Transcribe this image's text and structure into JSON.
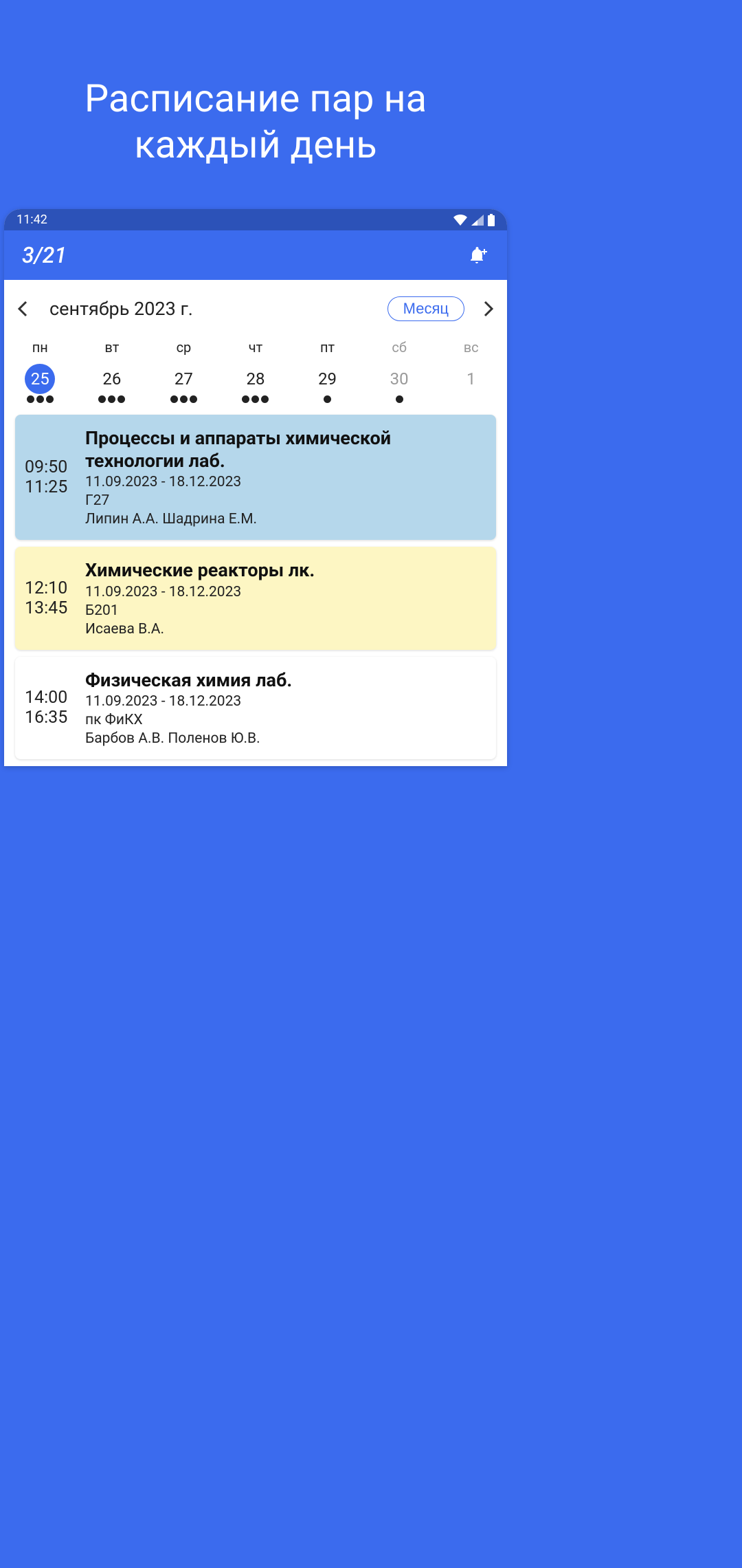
{
  "promo": {
    "title": "Расписание пар на каждый день"
  },
  "status_bar": {
    "time": "11:42"
  },
  "app_bar": {
    "title": "3/21"
  },
  "calendar": {
    "month_label": "сентябрь 2023 г.",
    "view_mode": "Месяц",
    "weekdays": [
      {
        "label": "пн",
        "muted": false
      },
      {
        "label": "вт",
        "muted": false
      },
      {
        "label": "ср",
        "muted": false
      },
      {
        "label": "чт",
        "muted": false
      },
      {
        "label": "пт",
        "muted": false
      },
      {
        "label": "сб",
        "muted": true
      },
      {
        "label": "вс",
        "muted": true
      }
    ],
    "days": [
      {
        "num": "25",
        "selected": true,
        "muted": false,
        "dots": 3
      },
      {
        "num": "26",
        "selected": false,
        "muted": false,
        "dots": 3
      },
      {
        "num": "27",
        "selected": false,
        "muted": false,
        "dots": 3
      },
      {
        "num": "28",
        "selected": false,
        "muted": false,
        "dots": 3
      },
      {
        "num": "29",
        "selected": false,
        "muted": false,
        "dots": 1
      },
      {
        "num": "30",
        "selected": false,
        "muted": true,
        "dots": 1
      },
      {
        "num": "1",
        "selected": false,
        "muted": true,
        "dots": 0
      }
    ]
  },
  "lessons": [
    {
      "start": "09:50",
      "end": "11:25",
      "title": "Процессы и аппараты химической технологии лаб.",
      "dates": "11.09.2023 - 18.12.2023",
      "room": "Г27",
      "teachers": "Липин А.А. Шадрина Е.М.",
      "color": "blue"
    },
    {
      "start": "12:10",
      "end": "13:45",
      "title": "Химические реакторы лк.",
      "dates": "11.09.2023 - 18.12.2023",
      "room": "Б201",
      "teachers": "Исаева В.А.",
      "color": "yellow"
    },
    {
      "start": "14:00",
      "end": "16:35",
      "title": "Физическая химия лаб.",
      "dates": "11.09.2023 - 18.12.2023",
      "room": "пк ФиКХ",
      "teachers": "Барбов А.В. Поленов Ю.В.",
      "color": "white"
    }
  ]
}
